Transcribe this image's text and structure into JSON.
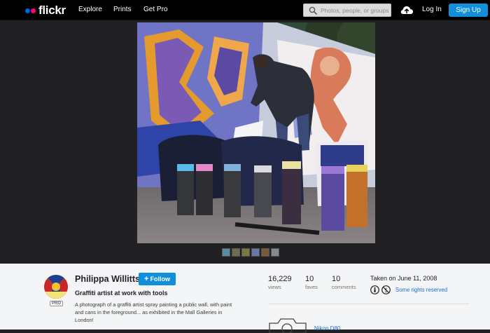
{
  "nav": {
    "logo_text": "flickr",
    "links": [
      "Explore",
      "Prints",
      "Get Pro"
    ],
    "search_placeholder": "Photos, people, or groups",
    "login": "Log In",
    "signup": "Sign Up"
  },
  "colors": {
    "brand_blue": "#0063dc",
    "brand_pink": "#ff0084",
    "button_blue": "#128fdc"
  },
  "photo": {
    "thumbnail_count": 6
  },
  "owner": {
    "name": "Philippa Willitts",
    "follow_label": "Follow",
    "follow_icon": "plus-icon",
    "pro_badge": "PRO"
  },
  "details": {
    "title": "Graffiti artist at work with tools",
    "description": "A photograph of a graffiti artist spray painting a public wall, with paint and cans in the foreground... as exhibited in the Mall Galleries in London!"
  },
  "stats": [
    {
      "value": "16,229",
      "label": "views"
    },
    {
      "value": "10",
      "label": "faves"
    },
    {
      "value": "10",
      "label": "comments"
    }
  ],
  "meta": {
    "taken": "Taken on June 11, 2008",
    "license": "Some rights reserved",
    "license_icons": [
      "attribution-icon",
      "noncommercial-icon"
    ],
    "camera_partial": "Nikon D80"
  }
}
